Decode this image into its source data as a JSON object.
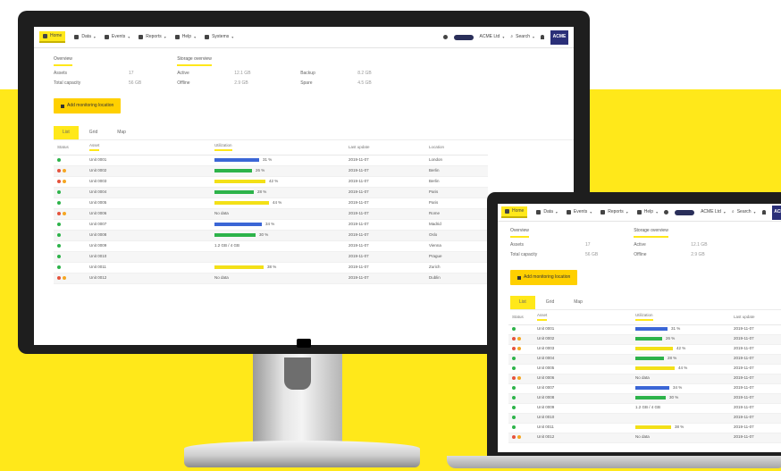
{
  "nav": [
    {
      "label": "Home",
      "icon": "home-icon",
      "active": true
    },
    {
      "label": "Data",
      "icon": "chart-icon",
      "active": false
    },
    {
      "label": "Events",
      "icon": "calendar-icon",
      "active": false
    },
    {
      "label": "Reports",
      "icon": "report-icon",
      "active": false
    },
    {
      "label": "Help",
      "icon": "help-icon",
      "active": false
    },
    {
      "label": "Systems",
      "icon": "filter-icon",
      "active": false
    }
  ],
  "topbar_right": {
    "account_label": "ACME Ltd",
    "search_label": "Search",
    "brand": "ACME"
  },
  "summary": {
    "left_title": "Overview",
    "left_rows": [
      {
        "label": "Assets",
        "value": "17"
      },
      {
        "label": "Total capacity",
        "value": "56 GB"
      }
    ],
    "right_title": "Storage overview",
    "right_rows": [
      {
        "label": "Active",
        "value": "12.1 GB",
        "label2": "Backup",
        "value2": "8.2 GB"
      },
      {
        "label": "Offline",
        "value": "2.9 GB",
        "label2": "Spare",
        "value2": "4.5 GB"
      }
    ]
  },
  "action_button": "Add monitoring location",
  "tabs": [
    "List",
    "Grid",
    "Map"
  ],
  "table": {
    "headers": [
      "Status",
      "Asset",
      "Utilization",
      "Last update",
      "Location"
    ],
    "rows": [
      {
        "status": [
          "#2db34a"
        ],
        "asset": "Unit 0001",
        "bar": {
          "color": "#3b66d6",
          "pct": 0.45
        },
        "util": "31 %",
        "date": "2019-11-07",
        "loc": "London"
      },
      {
        "status": [
          "#e5533d",
          "#f5a623"
        ],
        "asset": "Unit 0002",
        "bar": {
          "color": "#2db34a",
          "pct": 0.38
        },
        "util": "26 %",
        "date": "2019-11-07",
        "loc": "Berlin"
      },
      {
        "status": [
          "#e5533d",
          "#f5a623"
        ],
        "asset": "Unit 0003",
        "bar": {
          "color": "#f3e017",
          "pct": 0.52
        },
        "util": "42 %",
        "date": "2019-11-07",
        "loc": "Berlin"
      },
      {
        "status": [
          "#2db34a"
        ],
        "asset": "Unit 0004",
        "bar": {
          "color": "#2db34a",
          "pct": 0.4
        },
        "util": "28 %",
        "date": "2019-11-07",
        "loc": "Paris"
      },
      {
        "status": [
          "#2db34a"
        ],
        "asset": "Unit 0005",
        "bar": {
          "color": "#f3e017",
          "pct": 0.55
        },
        "util": "44 %",
        "date": "2019-11-07",
        "loc": "Paris"
      },
      {
        "status": [
          "#e5533d",
          "#f5a623"
        ],
        "asset": "Unit 0006",
        "bar": null,
        "util": "No data",
        "date": "2019-11-07",
        "loc": "Rome"
      },
      {
        "status": [
          "#2db34a"
        ],
        "asset": "Unit 0007",
        "bar": {
          "color": "#3b66d6",
          "pct": 0.48
        },
        "util": "34 %",
        "date": "2019-11-07",
        "loc": "Madrid"
      },
      {
        "status": [
          "#2db34a"
        ],
        "asset": "Unit 0008",
        "bar": {
          "color": "#2db34a",
          "pct": 0.42
        },
        "util": "30 %",
        "date": "2019-11-07",
        "loc": "Oslo"
      },
      {
        "status": [
          "#2db34a"
        ],
        "asset": "Unit 0009",
        "bar": null,
        "util": "1.2 GB / 4 GB",
        "date": "2019-11-07",
        "loc": "Vienna"
      },
      {
        "status": [
          "#2db34a"
        ],
        "asset": "Unit 0010",
        "bar": null,
        "util": "",
        "date": "2019-11-07",
        "loc": "Prague"
      },
      {
        "status": [
          "#2db34a"
        ],
        "asset": "Unit 0011",
        "bar": {
          "color": "#f3e017",
          "pct": 0.5
        },
        "util": "38 %",
        "date": "2019-11-07",
        "loc": "Zurich"
      },
      {
        "status": [
          "#e5533d",
          "#f5a623"
        ],
        "asset": "Unit 0012",
        "bar": null,
        "util": "No data",
        "date": "2019-11-07",
        "loc": "Dublin"
      }
    ]
  }
}
